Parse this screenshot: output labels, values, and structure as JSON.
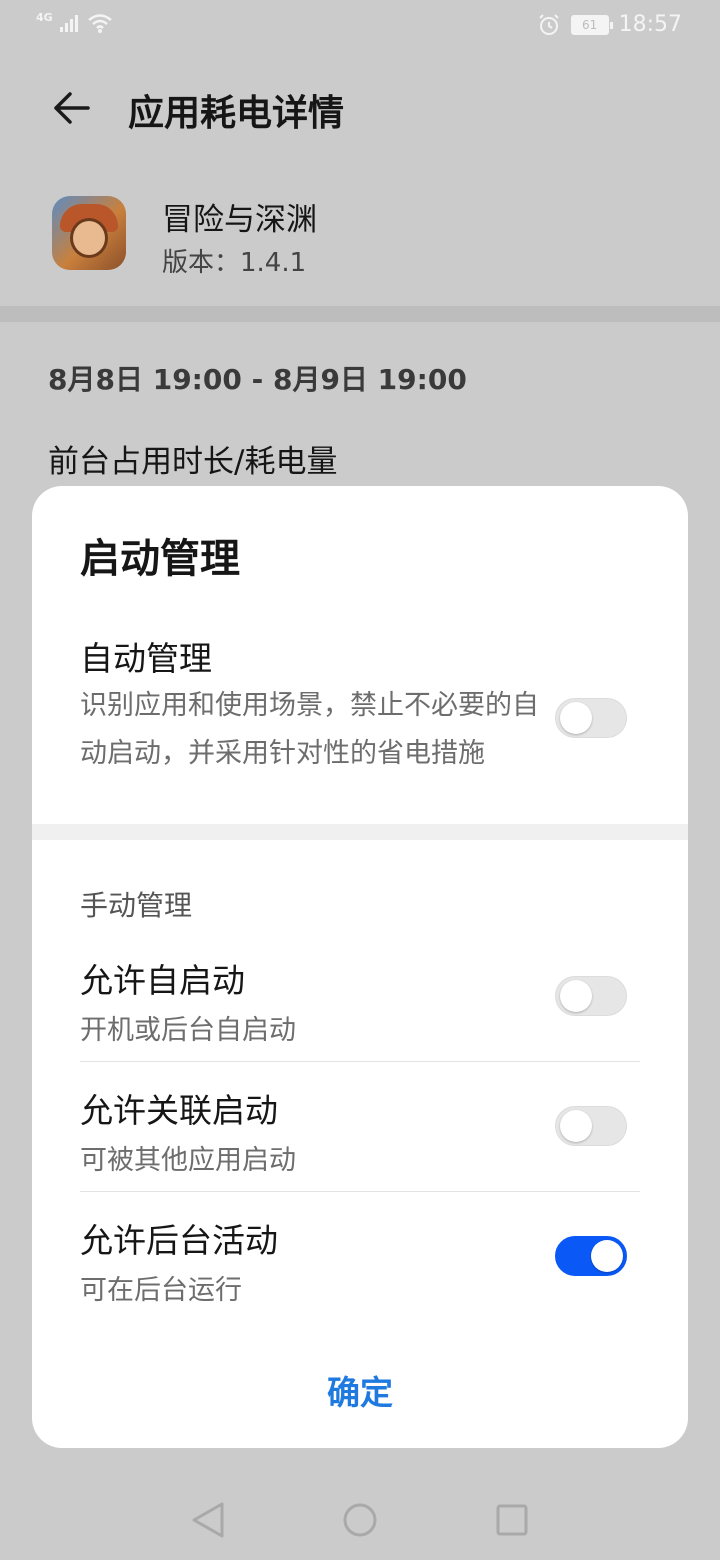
{
  "status_bar": {
    "network_label": "4G",
    "battery_level": "61",
    "time": "18:57"
  },
  "header": {
    "title": "应用耗电详情"
  },
  "app": {
    "name": "冒险与深渊",
    "version": "版本：1.4.1"
  },
  "date_range": "8月8日 19:00 - 8月9日 19:00",
  "usage_label": "前台占用时长/耗电量",
  "dialog": {
    "title": "启动管理",
    "auto": {
      "title": "自动管理",
      "description": "识别应用和使用场景，禁止不必要的自动启动，并采用针对性的省电措施",
      "enabled": false
    },
    "manual_label": "手动管理",
    "items": [
      {
        "title": "允许自启动",
        "subtitle": "开机或后台自启动",
        "enabled": false
      },
      {
        "title": "允许关联启动",
        "subtitle": "可被其他应用启动",
        "enabled": false
      },
      {
        "title": "允许后台活动",
        "subtitle": "可在后台运行",
        "enabled": true
      }
    ],
    "confirm_label": "确定"
  },
  "colors": {
    "accent": "#0a59f7",
    "confirm_text": "#1f7ae0",
    "scrim_background": "#cbcbcb"
  }
}
